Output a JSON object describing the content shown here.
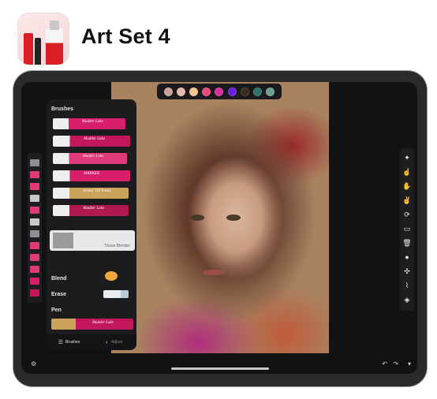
{
  "app": {
    "title": "Art Set 4"
  },
  "palette": {
    "colors": [
      "#c9a39a",
      "#e2b7ac",
      "#f2c48f",
      "#e8487a",
      "#d72f9b",
      "#6a1fe0",
      "#3a2a1c",
      "#2f6f66",
      "#6f9f94"
    ]
  },
  "panel": {
    "title": "Brushes",
    "brushes": [
      {
        "label": "Madder Lake",
        "color": "#d81f6c"
      },
      {
        "label": "Madder Lake",
        "color": "#c2185b"
      },
      {
        "label": "Madder Lake",
        "color": "#e03a7a"
      },
      {
        "label": "MARKER",
        "color": "#d81f6c"
      },
      {
        "label": "Artists' Oil Pastel",
        "color": "#c9a35a"
      },
      {
        "label": "Madder Lake",
        "color": "#b0194f"
      }
    ],
    "selected_brush": "Tissue Blender",
    "blend_label": "Blend",
    "erase_label": "Erase",
    "pen_label": "Pen",
    "pen_brand": "Madder Lake",
    "tabs": [
      {
        "label": "Brushes",
        "icon": "list-icon",
        "active": true
      },
      {
        "label": "Adjust",
        "icon": "adjust-icon",
        "active": false
      }
    ]
  },
  "left_tools": [
    "#8e8e93",
    "#e03a7a",
    "#e03a7a",
    "#c8c8c8",
    "#e03a7a",
    "#c8c8c8",
    "#8e8e93",
    "#e03a7a",
    "#e03a7a",
    "#e03a7a",
    "#d81f6c",
    "#c2185b"
  ],
  "right_tools": [
    "sparkle-brush-icon",
    "finger-icon",
    "hand-icon",
    "hand-up-icon",
    "rotate-icon",
    "ruler-icon",
    "trash-icon",
    "dot-icon",
    "fan-icon",
    "eyedropper-icon",
    "layers-icon"
  ],
  "bottombar": {
    "settings_icon": "gear-icon",
    "undo_icon": "undo-icon",
    "redo_icon": "redo-icon",
    "menu_icon": "chevron-down-icon"
  }
}
